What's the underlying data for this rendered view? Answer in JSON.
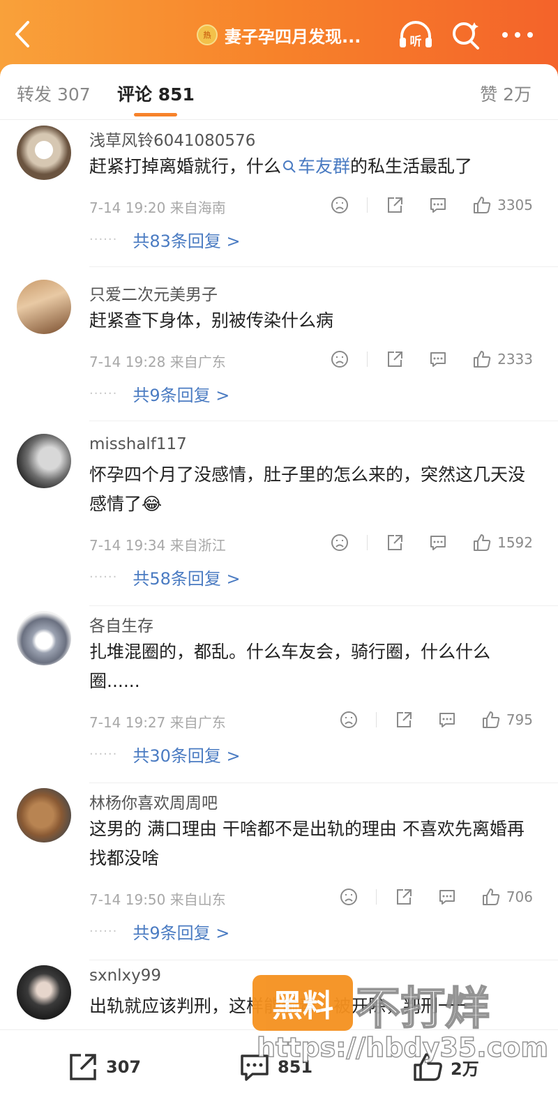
{
  "header": {
    "title": "妻子孕四月发现...",
    "badge_icon": "hot-topic-badge-icon",
    "badge_text": "热",
    "listen_label": "听"
  },
  "tabs": {
    "repost": "转发 307",
    "comment": "评论 851",
    "likes": "赞 2万"
  },
  "comments": [
    {
      "user": "浅草风铃6041080576",
      "text_before": "赶紧打掉离婚就行，什么",
      "topic": "车友群",
      "text_after": "的私生活最乱了",
      "time": "7-14 19:20",
      "location": "来自海南",
      "likes": "3305",
      "replies": "共83条回复 >"
    },
    {
      "user": "只爱二次元美男子",
      "text": "赶紧查下身体，别被传染什么病",
      "time": "7-14 19:28",
      "location": "来自广东",
      "likes": "2333",
      "replies": "共9条回复 >"
    },
    {
      "user": "misshalf117",
      "text": "怀孕四个月了没感情，肚子里的怎么来的，突然这几天没感情了",
      "emoji": "😂",
      "time": "7-14 19:34",
      "location": "来自浙江",
      "likes": "1592",
      "replies": "共58条回复 >"
    },
    {
      "user": "各自生存",
      "text": "扎堆混圈的，都乱。什么车友会，骑行圈，什么什么圈......",
      "time": "7-14 19:27",
      "location": "来自广东",
      "likes": "795",
      "replies": "共30条回复 >"
    },
    {
      "user": "林杨你喜欢周周吧",
      "text": "这男的 满口理由 干啥都不是出轨的理由 不喜欢先离婚再找都没啥",
      "time": "7-14 19:50",
      "location": "来自山东",
      "likes": "706",
      "replies": "共9条回复 >"
    },
    {
      "user": "sxnlxy99",
      "text": "出轨就应该判刑，这样能偷毒，被开除，判刑一一"
    }
  ],
  "bottom": {
    "repost": "307",
    "comment": "851",
    "like": "2万"
  },
  "watermark": {
    "badge": "黑料",
    "text": "不打烊",
    "url": "https://hbdy35.com"
  },
  "colors": {
    "header_gradient_start": "#f9a13a",
    "header_gradient_end": "#f4632a",
    "accent": "#f7822a",
    "link": "#4a7bc2"
  }
}
